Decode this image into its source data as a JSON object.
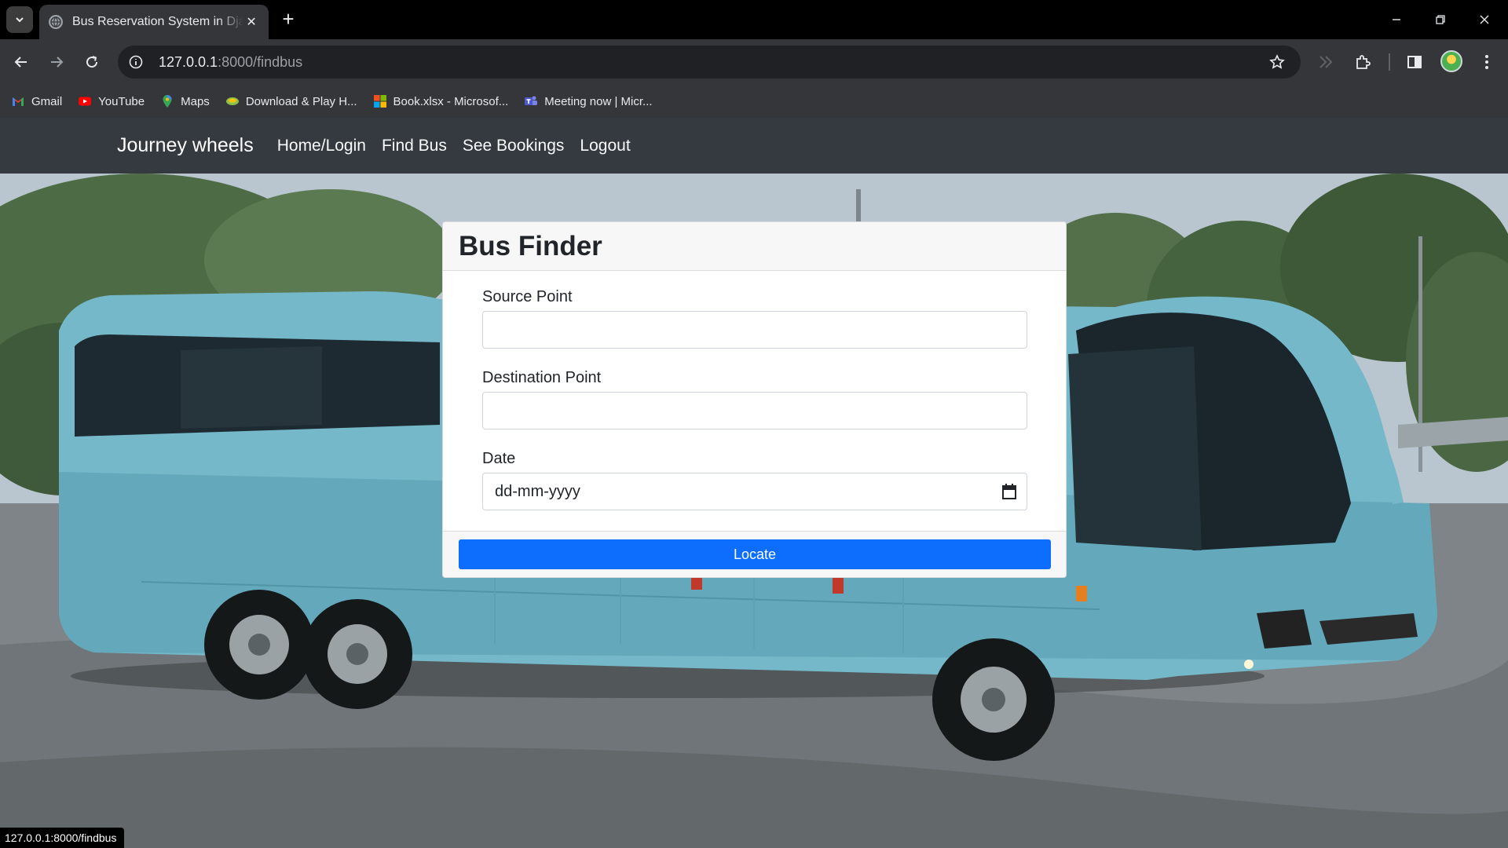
{
  "browser": {
    "tab_title": "Bus Reservation System in Django",
    "url_host": "127.0.0.1",
    "url_path": ":8000/findbus",
    "status_url": "127.0.0.1:8000/findbus",
    "bookmarks": [
      {
        "label": "Gmail",
        "icon": "gmail-icon"
      },
      {
        "label": "YouTube",
        "icon": "youtube-icon"
      },
      {
        "label": "Maps",
        "icon": "maps-icon"
      },
      {
        "label": "Download & Play H...",
        "icon": "game-icon"
      },
      {
        "label": "Book.xlsx - Microsof...",
        "icon": "microsoft-icon"
      },
      {
        "label": "Meeting now | Micr...",
        "icon": "teams-icon"
      }
    ]
  },
  "navbar": {
    "brand": "Journey wheels",
    "links": [
      "Home/Login",
      "Find Bus",
      "See Bookings",
      "Logout"
    ]
  },
  "form": {
    "title": "Bus Finder",
    "source_label": "Source Point",
    "source_value": "",
    "destination_label": "Destination Point",
    "destination_value": "",
    "date_label": "Date",
    "date_placeholder": "dd-mm-yyyy",
    "submit_label": "Locate"
  },
  "colors": {
    "navbar_bg": "#343a40",
    "button_bg": "#0d6efd",
    "bus_body": "#74b8c9"
  }
}
